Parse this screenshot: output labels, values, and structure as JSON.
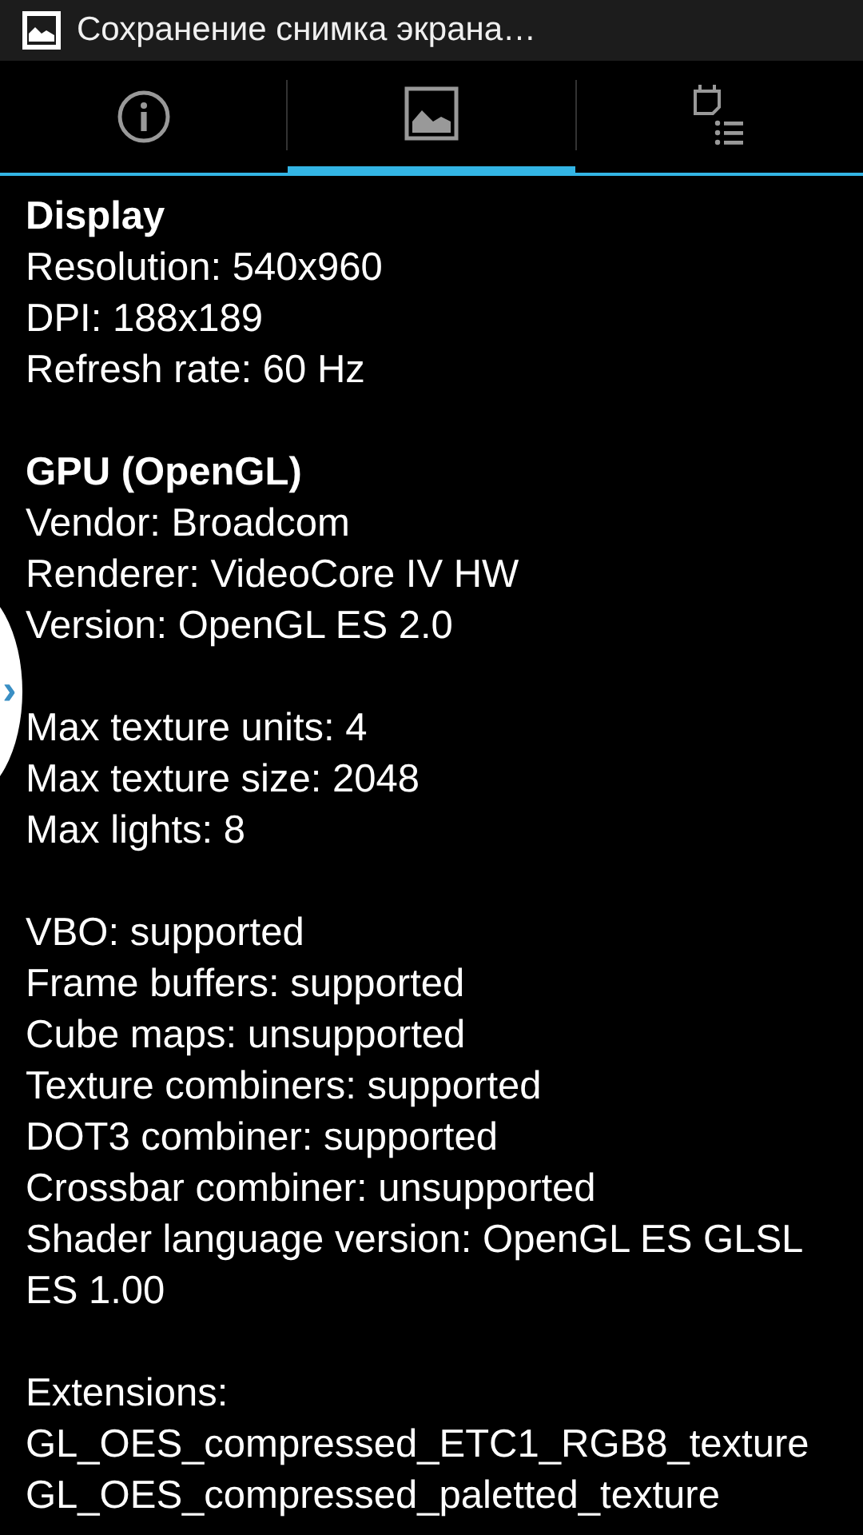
{
  "status_bar": {
    "notification": "Сохранение снимка экрана…"
  },
  "tabs": [
    {
      "kind": "info",
      "selected": false
    },
    {
      "kind": "picture",
      "selected": true
    },
    {
      "kind": "schedule",
      "selected": false
    }
  ],
  "sections": [
    {
      "title": "Display",
      "lines": [
        "Resolution: 540x960",
        "DPI: 188x189",
        "Refresh rate: 60 Hz"
      ]
    },
    {
      "title": "GPU (OpenGL)",
      "lines": [
        "Vendor: Broadcom",
        "Renderer: VideoCore IV HW",
        "Version: OpenGL ES 2.0"
      ]
    },
    {
      "lines": [
        "Max texture units: 4",
        "Max texture size: 2048",
        "Max lights: 8"
      ]
    },
    {
      "lines": [
        "VBO: supported",
        "Frame buffers: supported",
        "Cube maps: unsupported",
        "Texture combiners: supported",
        "DOT3 combiner: supported",
        "Crossbar combiner: unsupported",
        "Shader language version: OpenGL ES GLSL ES 1.00"
      ]
    },
    {
      "lines": [
        "Extensions:",
        "GL_OES_compressed_ETC1_RGB8_texture",
        "GL_OES_compressed_paletted_texture"
      ]
    }
  ],
  "side_handle": {
    "glyph": "›"
  }
}
